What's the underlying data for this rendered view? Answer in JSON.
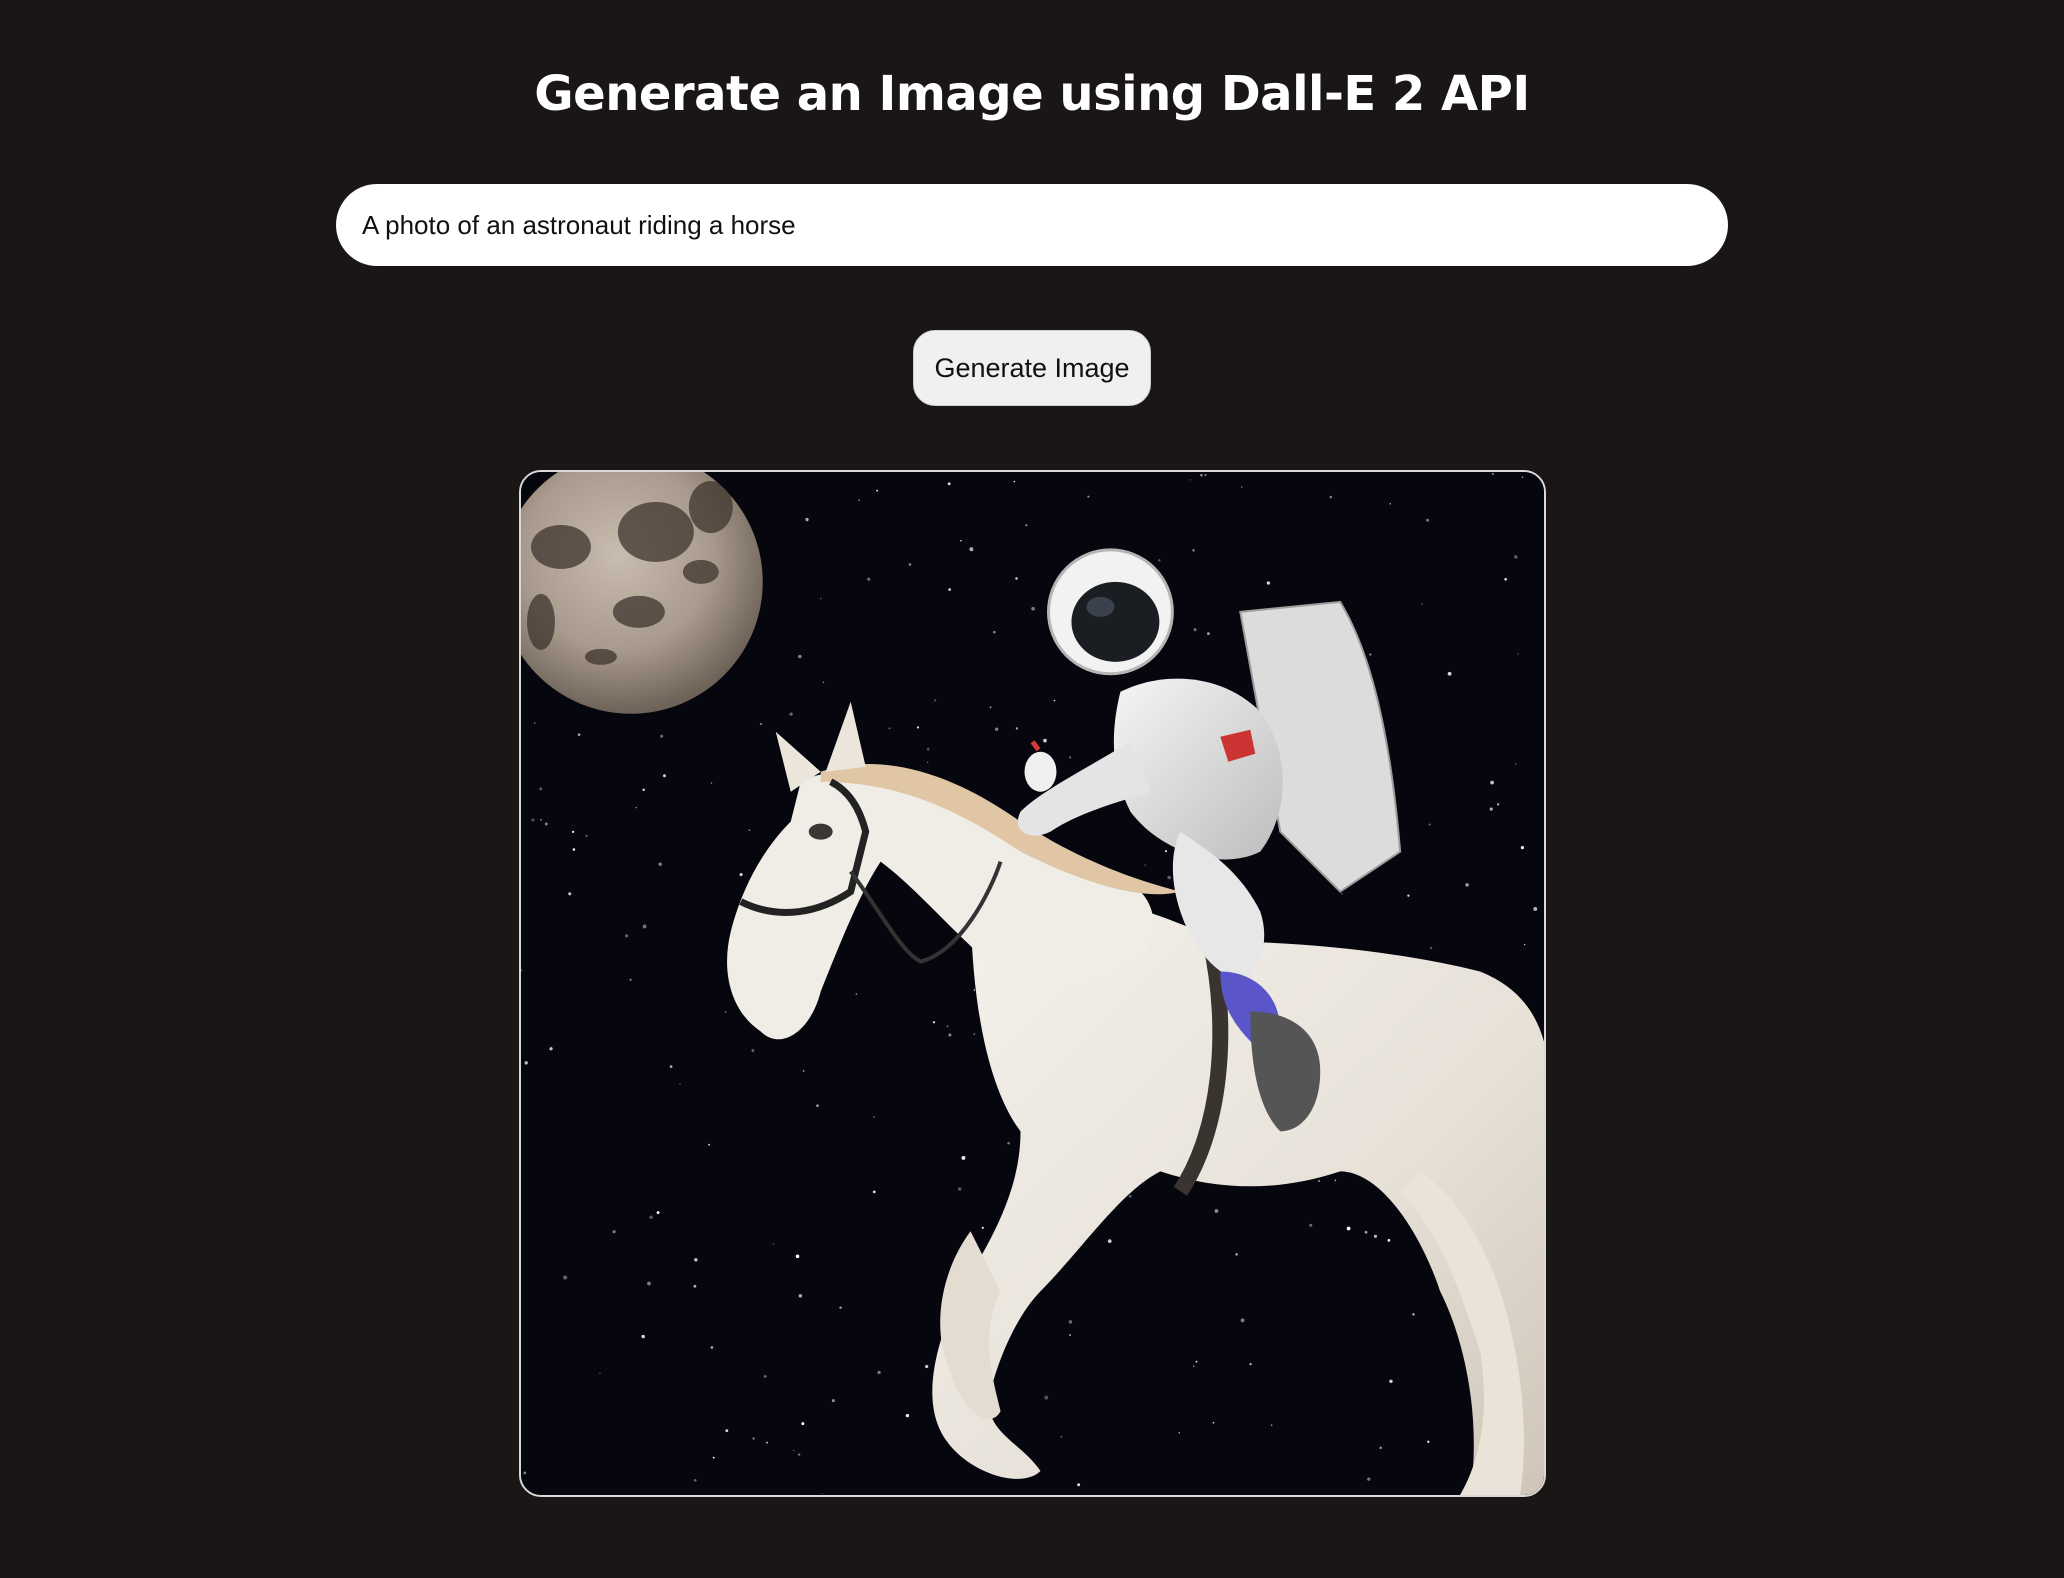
{
  "header": {
    "title": "Generate an Image using Dall-E 2 API"
  },
  "prompt": {
    "value": "A photo of an astronaut riding a horse",
    "placeholder": ""
  },
  "actions": {
    "generate_label": "Generate Image"
  },
  "result": {
    "alt": "A photo of an astronaut riding a horse"
  },
  "colors": {
    "background": "#1b1616",
    "title": "#ffffff",
    "input_bg": "#ffffff",
    "button_bg": "#f0f0f0",
    "image_border": "#d9d9d9"
  }
}
